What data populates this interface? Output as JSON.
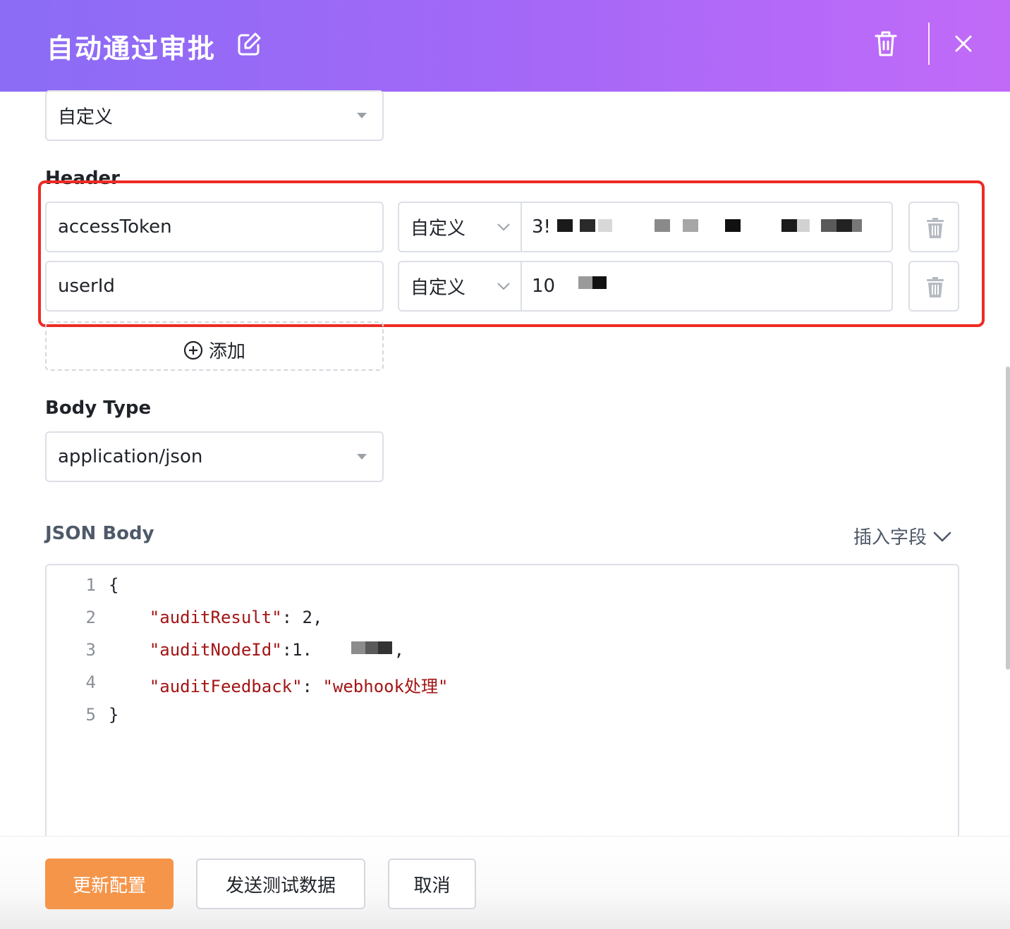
{
  "dialog": {
    "title": "自动通过审批",
    "icons": {
      "edit": "edit-icon",
      "delete": "trash-icon",
      "close": "close-icon"
    }
  },
  "method_select": {
    "value": "自定义"
  },
  "header_section": {
    "label": "Header",
    "rows": [
      {
        "key": "accessToken",
        "type": "自定义",
        "value": "3!",
        "value_tail": "ia4cd5."
      },
      {
        "key": "userId",
        "type": "自定义",
        "value": "10"
      }
    ],
    "add_label": "添加"
  },
  "body_type": {
    "label": "Body Type",
    "value": "application/json"
  },
  "json_body": {
    "label": "JSON Body",
    "insert_field_label": "插入字段",
    "lines": [
      {
        "num": "1",
        "parts": [
          {
            "t": "{",
            "c": "pun"
          }
        ]
      },
      {
        "num": "2",
        "parts": [
          {
            "t": "    ",
            "c": "pun"
          },
          {
            "t": "\"auditResult\"",
            "c": "str"
          },
          {
            "t": ": 2,",
            "c": "pun"
          }
        ]
      },
      {
        "num": "3",
        "parts": [
          {
            "t": "    ",
            "c": "pun"
          },
          {
            "t": "\"auditNodeId\"",
            "c": "str"
          },
          {
            "t": ":1.",
            "c": "pun"
          },
          {
            "t": "     ",
            "c": "pun"
          },
          {
            "t": "54 ,",
            "c": "pun"
          }
        ]
      },
      {
        "num": "4",
        "parts": [
          {
            "t": "    ",
            "c": "pun"
          },
          {
            "t": "\"auditFeedback\"",
            "c": "str"
          },
          {
            "t": ": ",
            "c": "pun"
          },
          {
            "t": "\"webhook处理\"",
            "c": "str"
          }
        ]
      },
      {
        "num": "5",
        "parts": [
          {
            "t": "}",
            "c": "pun"
          }
        ]
      }
    ]
  },
  "footer": {
    "update_label": "更新配置",
    "send_test_label": "发送测试数据",
    "cancel_label": "取消"
  },
  "colors": {
    "header_gradient_start": "#8b6cf5",
    "header_gradient_end": "#c26af8",
    "primary_button": "#f5954a",
    "highlight_border": "#ee2b24",
    "json_string": "#a31515"
  }
}
